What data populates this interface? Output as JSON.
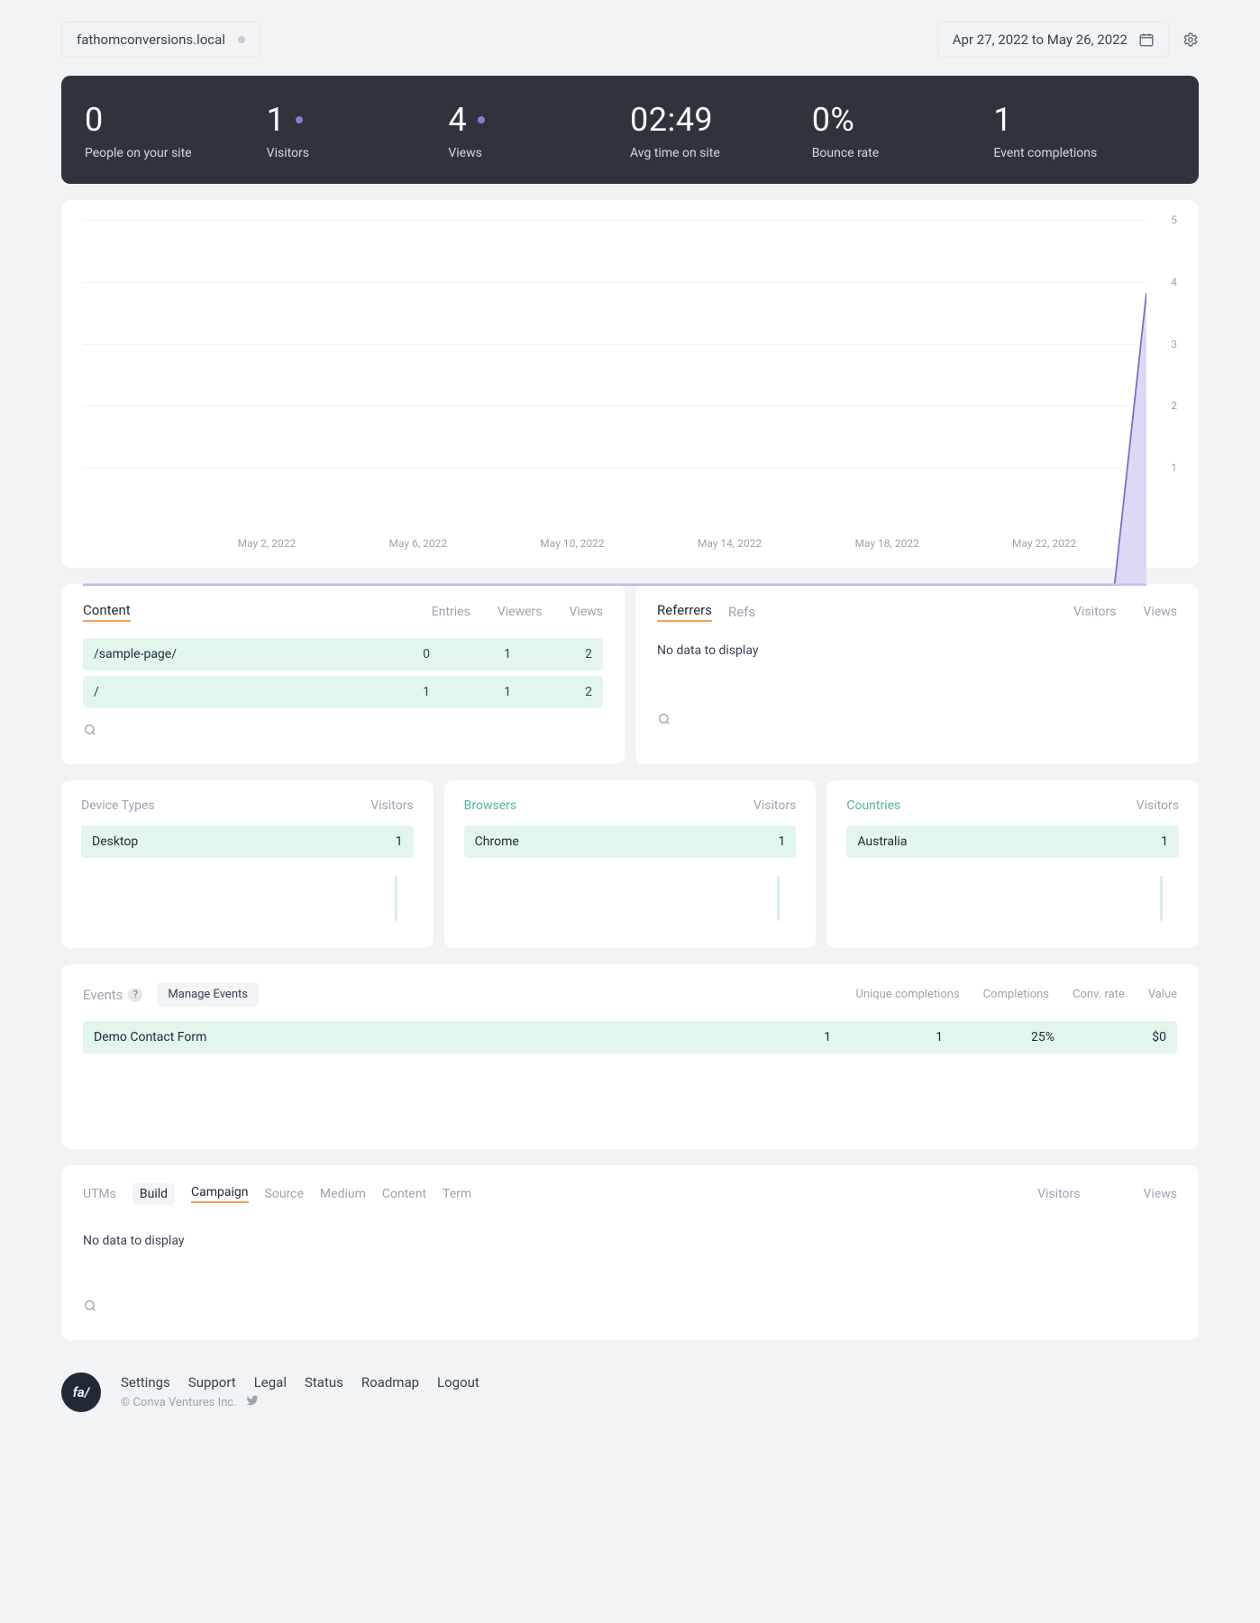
{
  "header": {
    "site": "fathomconversions.local",
    "date_range": "Apr 27, 2022 to May 26, 2022"
  },
  "stats": [
    {
      "value": "0",
      "label": "People on your site",
      "pulse": false
    },
    {
      "value": "1",
      "label": "Visitors",
      "pulse": true
    },
    {
      "value": "4",
      "label": "Views",
      "pulse": true
    },
    {
      "value": "02:49",
      "label": "Avg time on site",
      "pulse": false
    },
    {
      "value": "0%",
      "label": "Bounce rate",
      "pulse": false
    },
    {
      "value": "1",
      "label": "Event completions",
      "pulse": false
    }
  ],
  "chart_data": {
    "type": "area",
    "x_labels": [
      "May 2, 2022",
      "May 6, 2022",
      "May 10, 2022",
      "May 14, 2022",
      "May 18, 2022",
      "May 22, 2022"
    ],
    "y_ticks": [
      1,
      2,
      3,
      4,
      5
    ],
    "ylim": [
      0,
      5
    ],
    "series": [
      {
        "name": "Views",
        "last_value": 4
      }
    ],
    "title": "",
    "xlabel": "",
    "ylabel": ""
  },
  "content_panel": {
    "tab": "Content",
    "cols": [
      "Entries",
      "Viewers",
      "Views"
    ],
    "rows": [
      {
        "path": "/sample-page/",
        "entries": "0",
        "viewers": "1",
        "views": "2"
      },
      {
        "path": "/",
        "entries": "1",
        "viewers": "1",
        "views": "2"
      }
    ]
  },
  "referrers_panel": {
    "tabs": [
      "Referrers",
      "Refs"
    ],
    "cols": [
      "Visitors",
      "Views"
    ],
    "no_data": "No data to display"
  },
  "devices": {
    "title": "Device Types",
    "col": "Visitors",
    "rows": [
      {
        "name": "Desktop",
        "value": "1"
      }
    ]
  },
  "browsers": {
    "title": "Browsers",
    "col": "Visitors",
    "rows": [
      {
        "name": "Chrome",
        "value": "1"
      }
    ]
  },
  "countries": {
    "title": "Countries",
    "col": "Visitors",
    "rows": [
      {
        "name": "Australia",
        "value": "1"
      }
    ]
  },
  "events": {
    "title": "Events",
    "manage": "Manage Events",
    "cols": [
      "Unique completions",
      "Completions",
      "Conv. rate",
      "Value"
    ],
    "rows": [
      {
        "name": "Demo Contact Form",
        "unique": "1",
        "completions": "1",
        "rate": "25%",
        "value": "$0"
      }
    ]
  },
  "utms": {
    "label": "UTMs",
    "tabs": [
      "Build",
      "Campaign",
      "Source",
      "Medium",
      "Content",
      "Term"
    ],
    "cols": [
      "Visitors",
      "Views"
    ],
    "no_data": "No data to display"
  },
  "footer": {
    "logo": "fa/",
    "links": [
      "Settings",
      "Support",
      "Legal",
      "Status",
      "Roadmap",
      "Logout"
    ],
    "copyright": "© Conva Ventures Inc."
  }
}
